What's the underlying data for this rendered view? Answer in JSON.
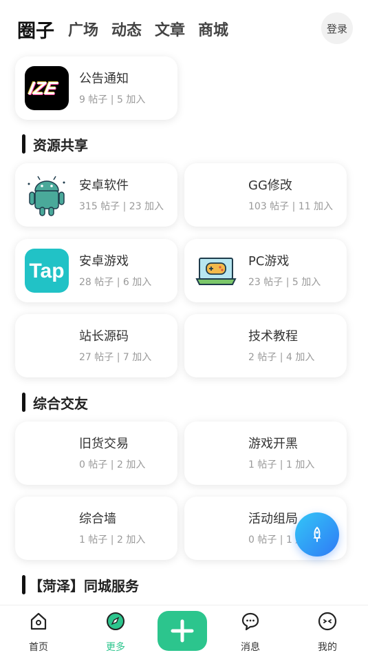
{
  "top_nav": {
    "tabs": [
      "圈子",
      "广场",
      "动态",
      "文章",
      "商城"
    ],
    "login_label": "登录"
  },
  "announcement": {
    "name": "公告通知",
    "stats": "9 帖子 | 5 加入",
    "logo_text": "IZE"
  },
  "sections": [
    {
      "title": "资源共享",
      "cards": [
        {
          "name": "安卓软件",
          "stats": "315 帖子 | 23 加入",
          "icon": "android-robot-icon"
        },
        {
          "name": "GG修改",
          "stats": "103 帖子 | 11 加入",
          "icon": ""
        },
        {
          "name": "安卓游戏",
          "stats": "28 帖子 | 6 加入",
          "icon": "tap-logo-icon",
          "logo_text": "Tap"
        },
        {
          "name": "PC游戏",
          "stats": "23 帖子 | 5 加入",
          "icon": "laptop-gamepad-icon"
        },
        {
          "name": "站长源码",
          "stats": "27 帖子 | 7 加入",
          "icon": ""
        },
        {
          "name": "技术教程",
          "stats": "2 帖子 | 4 加入",
          "icon": ""
        }
      ]
    },
    {
      "title": "综合交友",
      "cards": [
        {
          "name": "旧货交易",
          "stats": "0 帖子 | 2 加入",
          "icon": ""
        },
        {
          "name": "游戏开黑",
          "stats": "1 帖子 | 1 加入",
          "icon": ""
        },
        {
          "name": "综合墙",
          "stats": "1 帖子 | 2 加入",
          "icon": ""
        },
        {
          "name": "活动组局",
          "stats": "0 帖子 | 1 加入",
          "icon": ""
        }
      ]
    },
    {
      "title": "【菏泽】同城服务",
      "cards": []
    }
  ],
  "bottom_nav": {
    "items": [
      {
        "label": "首页",
        "icon": "home-icon"
      },
      {
        "label": "更多",
        "icon": "compass-icon",
        "active": true
      },
      {
        "label": "",
        "icon": "plus-icon"
      },
      {
        "label": "消息",
        "icon": "chat-bubbles-icon"
      },
      {
        "label": "我的",
        "icon": "face-icon"
      }
    ]
  },
  "colors": {
    "accent": "#2cc58d",
    "fab_start": "#33c6f7",
    "fab_end": "#2f7af5",
    "tap_bg": "#21c2c6"
  }
}
